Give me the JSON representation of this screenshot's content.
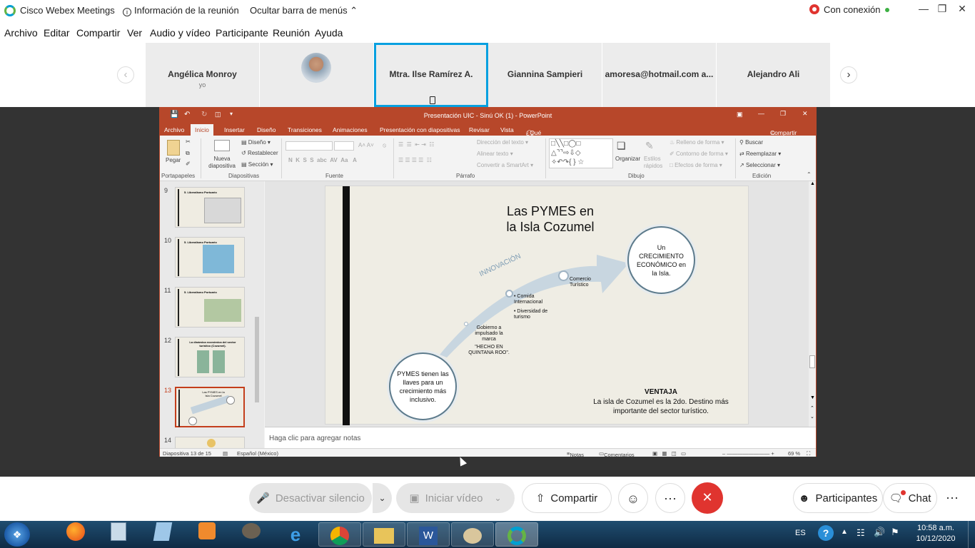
{
  "webex": {
    "app_name": "Cisco Webex Meetings",
    "meeting_info": "Información de la reunión",
    "hide_menu": "Ocultar barra de menús",
    "connection": "Con conexión",
    "menu": [
      "Archivo",
      "Editar",
      "Compartir",
      "Ver",
      "Audio y vídeo",
      "Participante",
      "Reunión",
      "Ayuda"
    ],
    "participants": [
      {
        "name": "Angélica Monroy",
        "sub": "yo"
      },
      {
        "name": "",
        "sub": ""
      },
      {
        "name": "Mtra. Ilse Ramírez A.",
        "sub": ""
      },
      {
        "name": "Giannina Sampieri",
        "sub": ""
      },
      {
        "name": "amoresa@hotmail.com a...",
        "sub": ""
      },
      {
        "name": "Alejandro Ali",
        "sub": ""
      }
    ],
    "controls": {
      "mute": "Desactivar silencio",
      "video": "Iniciar vídeo",
      "share": "Compartir",
      "participants": "Participantes",
      "chat": "Chat"
    },
    "colors": {
      "accent": "#07a0e0",
      "end_call": "#e0342f"
    }
  },
  "ppt": {
    "title": "Presentación UIC - Sinú OK (1) - PowerPoint",
    "tabs": [
      "Archivo",
      "Inicio",
      "Insertar",
      "Diseño",
      "Transiciones",
      "Animaciones",
      "Presentación con diapositivas",
      "Revisar",
      "Vista"
    ],
    "tell_me": "¿Qué desea hacer?",
    "share": "Compartir",
    "ribbon": {
      "paste": "Pegar",
      "new_slide": "Nueva diapositiva",
      "layout": "Diseño",
      "reset": "Restablecer",
      "section": "Sección",
      "text_direction": "Dirección del texto",
      "align_text": "Alinear texto",
      "smartart": "Convertir a SmartArt",
      "arrange": "Organizar",
      "quick_styles": "Estilos rápidos",
      "shape_fill": "Relleno de forma",
      "shape_outline": "Contorno de forma",
      "shape_effects": "Efectos de forma",
      "find": "Buscar",
      "replace": "Reemplazar",
      "select": "Seleccionar",
      "groups": [
        "Portapapeles",
        "Diapositivas",
        "Fuente",
        "Párrafo",
        "Dibujo",
        "Edición"
      ]
    },
    "thumbnails": [
      {
        "num": "9",
        "title": "5. Liberalismo Portuario"
      },
      {
        "num": "10",
        "title": "5. Liberalismo Portuario"
      },
      {
        "num": "11",
        "title": "5. Liberalismo Portuario"
      },
      {
        "num": "12",
        "title": "La dinámica económica del sector turístico (Cozumel)."
      },
      {
        "num": "13",
        "title": "Las PYMES en la Isla Cozumel"
      },
      {
        "num": "14",
        "title": ""
      }
    ],
    "slide": {
      "title_line1": "Las PYMES en",
      "title_line2": "la Isla Cozumel",
      "innovation": "INNOVACIÓN",
      "left_circle": "PYMES tienen las llaves para un crecimiento más inclusivo.",
      "right_circle": "Un CRECIMIENTO ECONÓMICO en la Isla.",
      "point1": "Gobierno a impulsado la marca",
      "point1b": "\"HECHO EN QUINTANA ROO\".",
      "point2a": "• Comida Internacional",
      "point2b": "• Diversidad de turismo",
      "point3": "Comercio Turístico",
      "advantage_title": "VENTAJA",
      "advantage_text": "La isla de Cozumel es la 2do. Destino más importante del sector turístico."
    },
    "notes": "Haga clic para agregar notas",
    "status": {
      "slide": "Diapositiva 13 de 15",
      "language": "Español (México)",
      "notes": "Notas",
      "comments": "Comentarios",
      "zoom": "69 %"
    }
  },
  "taskbar": {
    "lang": "ES",
    "time": "10:58 a.m.",
    "date": "10/12/2020"
  }
}
